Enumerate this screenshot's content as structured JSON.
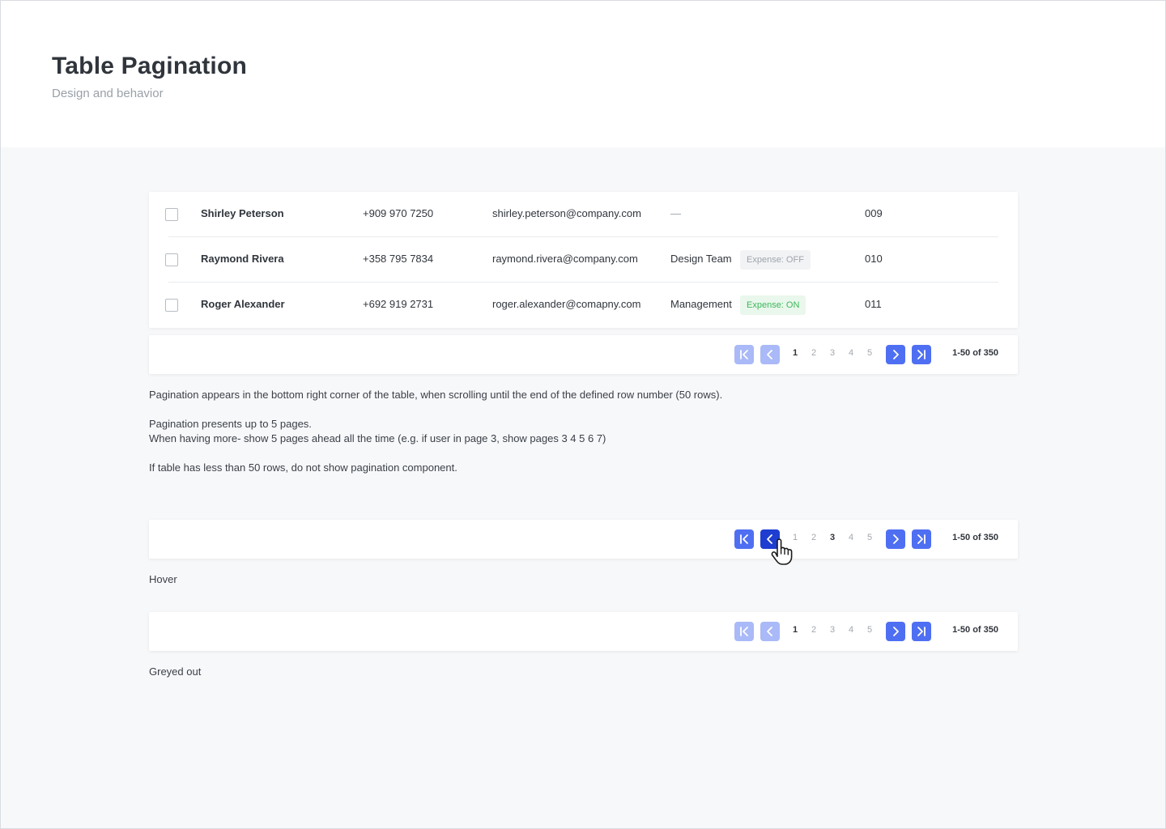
{
  "header": {
    "title": "Table Pagination",
    "subtitle": "Design and behavior"
  },
  "table": {
    "rows": [
      {
        "name": "Shirley Peterson",
        "phone": "+909 970 7250",
        "email": "shirley.peterson@company.com",
        "team": "—",
        "badge": "",
        "id": "009"
      },
      {
        "name": "Raymond Rivera",
        "phone": "+358 795 7834",
        "email": "raymond.rivera@company.com",
        "team": "Design Team",
        "badge": "Expense: OFF",
        "id": "010"
      },
      {
        "name": "Roger Alexander",
        "phone": "+692 919 2731",
        "email": "roger.alexander@comapny.com",
        "team": "Management",
        "badge": "Expense: ON",
        "id": "011"
      }
    ]
  },
  "pagination_default": {
    "pages": [
      "1",
      "2",
      "3",
      "4",
      "5"
    ],
    "current_page": "1",
    "range": "1-50 of 350"
  },
  "pagination_hover": {
    "pages": [
      "1",
      "2",
      "3",
      "4",
      "5"
    ],
    "current_page": "3",
    "range": "1-50 of 350",
    "caption": "Hover"
  },
  "pagination_greyed": {
    "pages": [
      "1",
      "2",
      "3",
      "4",
      "5"
    ],
    "current_page": "1",
    "range": "1-50 of 350",
    "caption": "Greyed out"
  },
  "notes": {
    "line1": "Pagination appears in the bottom right corner of the table, when scrolling until the end of the defined row number (50 rows).",
    "line2": "Pagination presents up to 5 pages.",
    "line3": "When having more- show 5 pages ahead all the time (e.g. if user in page 3, show pages 3 4 5 6 7)",
    "line4": "If table has less than 50 rows, do not show pagination component."
  },
  "icons": {
    "first": "first-page-icon",
    "prev": "chevron-left-icon",
    "next": "chevron-right-icon",
    "last": "last-page-icon",
    "cursor": "hand-pointer-icon"
  },
  "colors": {
    "accent": "#4f6ff2",
    "accent_disabled": "#aab9f7",
    "accent_hover": "#1e3ed1",
    "badge_on": "#3cb85a"
  }
}
